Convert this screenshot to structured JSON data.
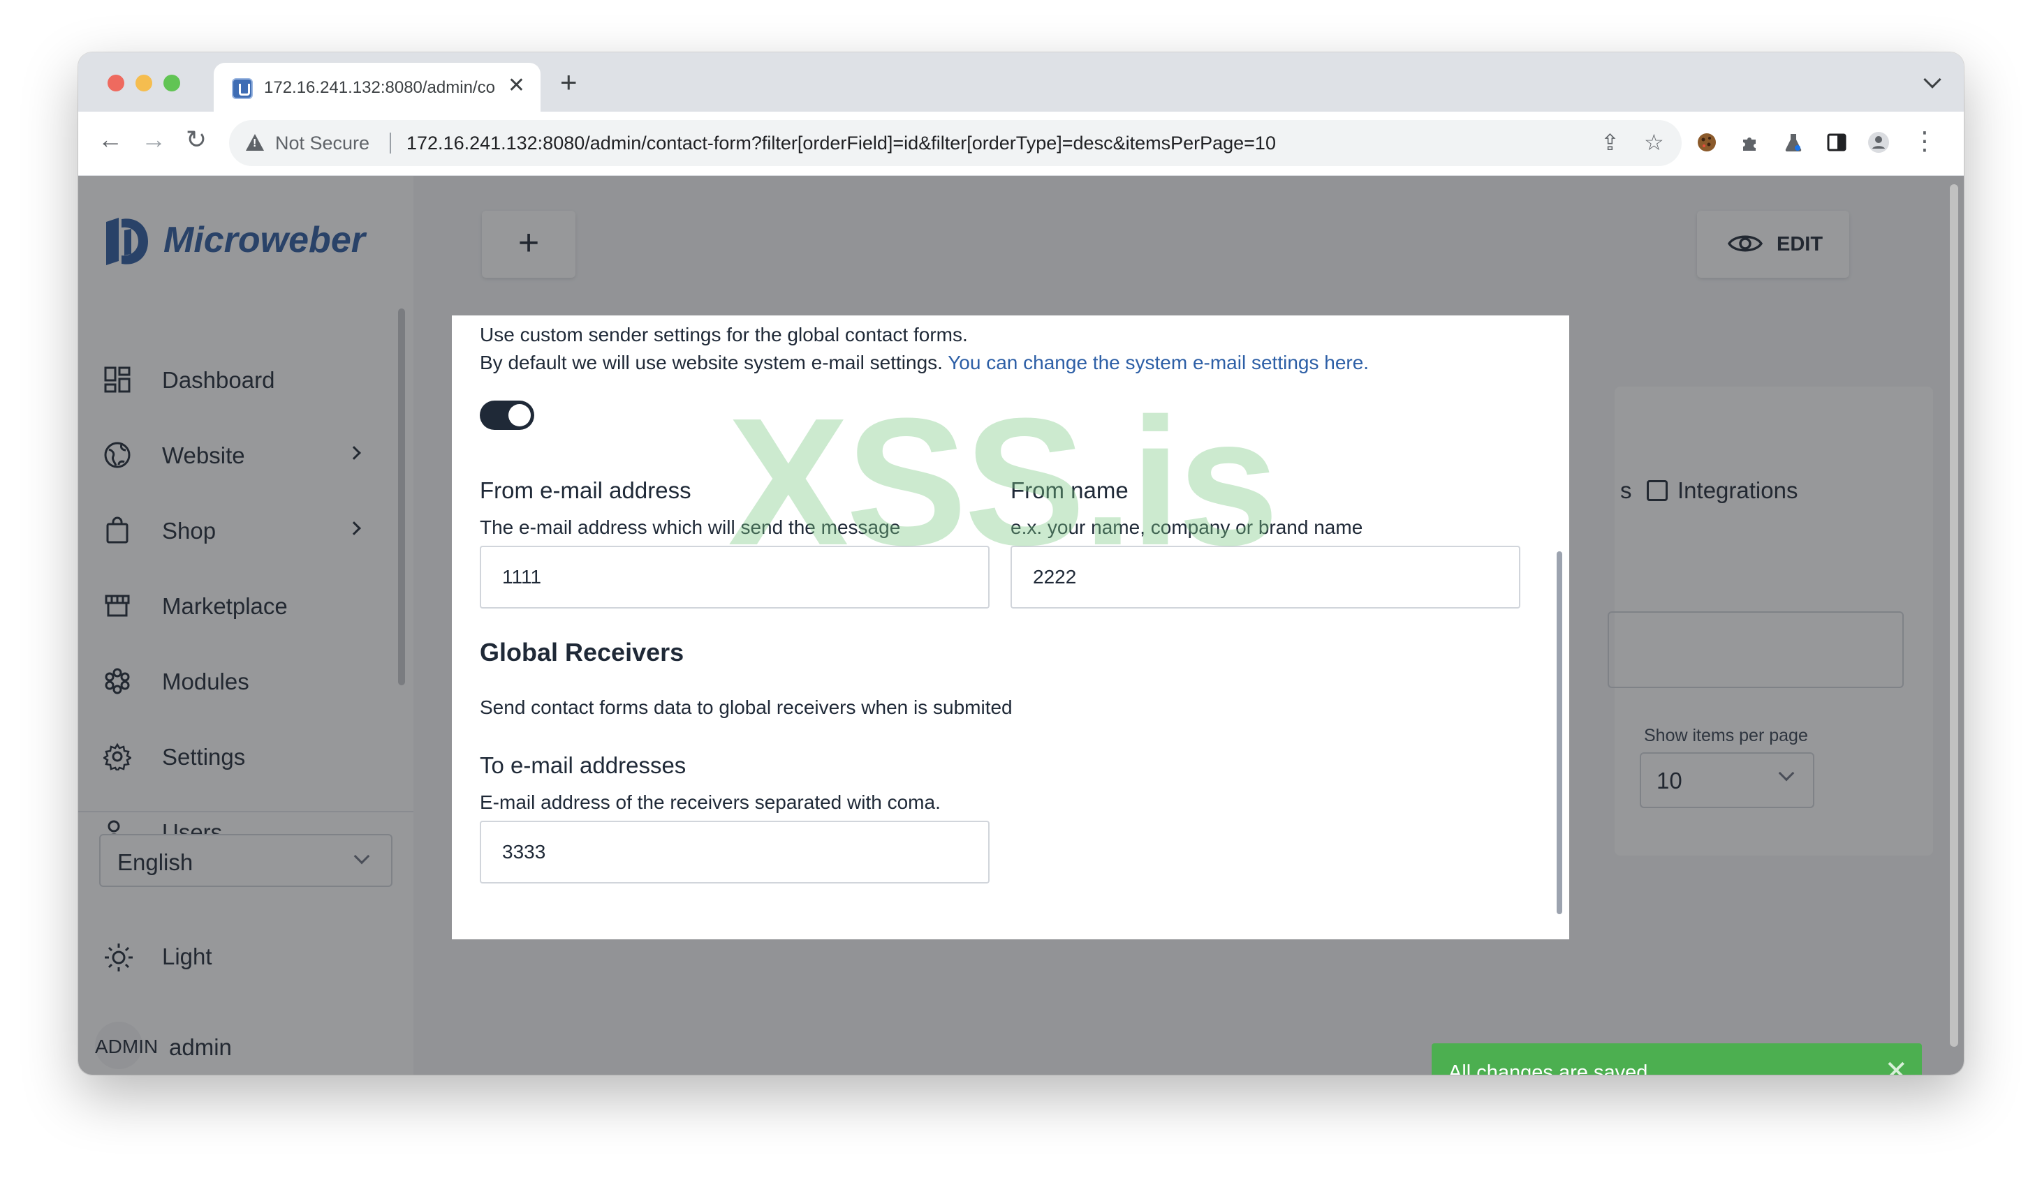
{
  "browser": {
    "tab_title": "172.16.241.132:8080/admin/co",
    "close_glyph": "✕",
    "new_tab_glyph": "+",
    "back_glyph": "←",
    "forward_glyph": "→",
    "reload_glyph": "↻",
    "security_label": "Not Secure",
    "url": "172.16.241.132:8080/admin/contact-form?filter[orderField]=id&filter[orderType]=desc&itemsPerPage=10",
    "share_glyph": "⇪",
    "star_glyph": "☆",
    "menu_glyph": "⋮"
  },
  "sidebar": {
    "logo_text": "Microweber",
    "items": [
      {
        "label": "Dashboard",
        "icon": "dashboard-icon"
      },
      {
        "label": "Website",
        "icon": "globe-icon"
      },
      {
        "label": "Shop",
        "icon": "shopping-bag-icon"
      },
      {
        "label": "Marketplace",
        "icon": "store-icon"
      },
      {
        "label": "Modules",
        "icon": "modules-icon"
      },
      {
        "label": "Settings",
        "icon": "gear-icon"
      },
      {
        "label": "Users",
        "icon": "users-icon"
      }
    ],
    "language": "English",
    "theme_label": "Light",
    "avatar_text": "ADMIN",
    "username": "admin"
  },
  "main": {
    "add_glyph": "+",
    "edit_label": "EDIT",
    "tab_fragment": "s",
    "integrations_label": "Integrations",
    "per_page_label": "Show items per page",
    "per_page_value": "10"
  },
  "modal": {
    "intro_line1": "Use custom sender settings for the global contact forms.",
    "intro_line2": "By default we will use website system e-mail settings.",
    "intro_link": "You can change the system e-mail settings here.",
    "toggle_on": true,
    "from_email_label": "From e-mail address",
    "from_email_help": "The e-mail address which will send the message",
    "from_email_value": "1111",
    "from_name_label": "From name",
    "from_name_help": "e.x. your name, company or brand name",
    "from_name_value": "2222",
    "receivers_title": "Global Receivers",
    "receivers_desc": "Send contact forms data to global receivers when is submited",
    "to_email_label": "To e-mail addresses",
    "to_email_help": "E-mail address of the receivers separated with coma.",
    "to_email_value": "3333"
  },
  "watermark": "XSS.is",
  "toast": {
    "message": "All changes are saved.",
    "close_glyph": "✕",
    "color": "#4caf50"
  },
  "colors": {
    "brand": "#2c5aa0",
    "link": "#2d5fa6",
    "toggle": "#1f2937"
  }
}
